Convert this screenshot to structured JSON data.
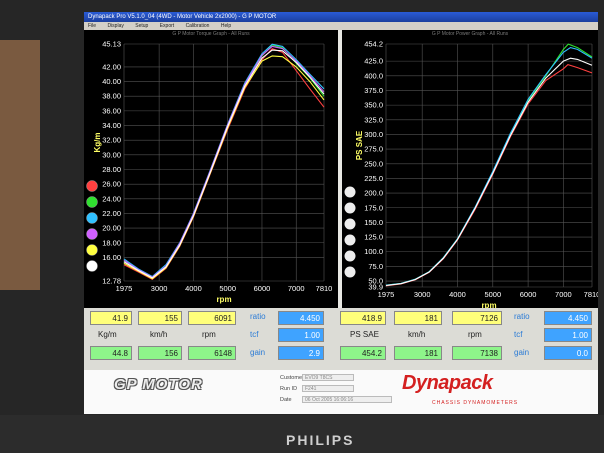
{
  "monitor": {
    "brand": "PHILIPS"
  },
  "window": {
    "title": "Dynapack Pro V5.1.0_04 (4WD - Motor Vehicle 2x2000) - G P MOTOR",
    "menu": [
      "File",
      "Display",
      "Setup",
      "Export",
      "Calibration",
      "Help"
    ]
  },
  "left_chart": {
    "panel_title": "G P Motor Torque Graph - All Runs",
    "ylabel": "Kg/m",
    "xlabel": "rpm",
    "y_ticks": [
      "45.13",
      "42.00",
      "40.00",
      "38.00",
      "36.00",
      "34.00",
      "32.00",
      "30.00",
      "28.00",
      "26.00",
      "24.00",
      "22.00",
      "20.00",
      "18.00",
      "16.00",
      "12.78"
    ],
    "x_ticks": [
      "1975",
      "3000",
      "4000",
      "5000",
      "6000",
      "7000",
      "7810"
    ]
  },
  "right_chart": {
    "panel_title": "G P Motor Power Graph - All Runs",
    "ylabel": "PS SAE",
    "xlabel": "rpm",
    "y_ticks": [
      "454.2",
      "425.0",
      "400.0",
      "375.0",
      "350.0",
      "325.0",
      "300.0",
      "275.0",
      "250.0",
      "225.0",
      "200.0",
      "175.0",
      "150.0",
      "125.0",
      "100.0",
      "75.0",
      "50.0",
      "39.9"
    ],
    "x_ticks": [
      "1975",
      "3000",
      "4000",
      "5000",
      "6000",
      "7000",
      "7810"
    ]
  },
  "chart_data": [
    {
      "type": "line",
      "ylabel": "Kg/m",
      "xlabel": "rpm",
      "xlim": [
        1975,
        7810
      ],
      "ylim": [
        12.78,
        45.13
      ],
      "series": [
        {
          "color": "#ff4040",
          "x": [
            1975,
            2400,
            2800,
            3200,
            3600,
            4000,
            4500,
            5000,
            5500,
            6000,
            6300,
            6600,
            7000,
            7400,
            7810
          ],
          "y": [
            15.0,
            14.0,
            13.0,
            14.5,
            17.5,
            21.5,
            27.5,
            33.5,
            39.0,
            43.0,
            44.5,
            44.0,
            41.5,
            39.0,
            36.5
          ]
        },
        {
          "color": "#30e030",
          "x": [
            1975,
            2400,
            2800,
            3200,
            3600,
            4000,
            4500,
            5000,
            5500,
            6000,
            6300,
            6600,
            7000,
            7400,
            7810
          ],
          "y": [
            15.5,
            14.2,
            13.2,
            14.7,
            17.8,
            21.8,
            27.8,
            34.0,
            39.5,
            43.5,
            45.0,
            44.6,
            42.5,
            40.5,
            38.0
          ]
        },
        {
          "color": "#30c0ff",
          "x": [
            1975,
            2400,
            2800,
            3200,
            3600,
            4000,
            4500,
            5000,
            5500,
            6000,
            6300,
            6600,
            7000,
            7400,
            7810
          ],
          "y": [
            15.8,
            14.4,
            13.4,
            15.0,
            18.0,
            22.0,
            28.0,
            34.2,
            39.8,
            43.8,
            45.1,
            44.8,
            43.0,
            41.0,
            39.0
          ]
        },
        {
          "color": "#d060ff",
          "x": [
            1975,
            2400,
            2800,
            3200,
            3600,
            4000,
            4500,
            5000,
            5500,
            6000,
            6300,
            6600,
            7000,
            7400,
            7810
          ],
          "y": [
            15.6,
            14.3,
            13.3,
            14.8,
            17.9,
            21.9,
            27.9,
            34.1,
            39.6,
            43.6,
            44.8,
            44.5,
            42.8,
            40.8,
            38.6
          ]
        },
        {
          "color": "#ffff40",
          "x": [
            1975,
            2400,
            2800,
            3200,
            3600,
            4000,
            4500,
            5000,
            5500,
            6000,
            6300,
            6600,
            7000,
            7400,
            7810
          ],
          "y": [
            15.2,
            14.1,
            13.1,
            14.6,
            17.6,
            21.6,
            27.6,
            33.7,
            39.2,
            42.8,
            43.5,
            43.4,
            42.0,
            40.0,
            37.5
          ]
        },
        {
          "color": "#ffffff",
          "x": [
            1975,
            2400,
            2800,
            3200,
            3600,
            4000,
            4500,
            5000,
            5500,
            6000,
            6300,
            6600,
            7000,
            7400,
            7810
          ],
          "y": [
            15.4,
            14.2,
            13.2,
            14.7,
            17.7,
            21.7,
            27.7,
            33.9,
            39.4,
            43.2,
            44.3,
            44.2,
            42.6,
            40.6,
            38.3
          ]
        }
      ]
    },
    {
      "type": "line",
      "ylabel": "PS SAE",
      "xlabel": "rpm",
      "xlim": [
        1975,
        7810
      ],
      "ylim": [
        39.9,
        454.2
      ],
      "series": [
        {
          "color": "#ff4040",
          "x": [
            1975,
            2400,
            2800,
            3200,
            3600,
            4000,
            4500,
            5000,
            5500,
            6000,
            6500,
            7000,
            7126,
            7400,
            7810
          ],
          "y": [
            42,
            45,
            52,
            65,
            88,
            120,
            172,
            232,
            296,
            352,
            392,
            412,
            419,
            414,
            405
          ]
        },
        {
          "color": "#30e030",
          "x": [
            1975,
            2400,
            2800,
            3200,
            3600,
            4000,
            4500,
            5000,
            5500,
            6000,
            6500,
            7000,
            7138,
            7400,
            7810
          ],
          "y": [
            43,
            46,
            53,
            66,
            90,
            122,
            175,
            236,
            300,
            358,
            400,
            445,
            454,
            448,
            432
          ]
        },
        {
          "color": "#30c0ff",
          "x": [
            1975,
            2400,
            2800,
            3200,
            3600,
            4000,
            4500,
            5000,
            5500,
            6000,
            6500,
            7000,
            7200,
            7400,
            7810
          ],
          "y": [
            43,
            46,
            53,
            66,
            90,
            122,
            176,
            237,
            302,
            360,
            402,
            440,
            448,
            445,
            430
          ]
        },
        {
          "color": "#ffffff",
          "x": [
            1975,
            2400,
            2800,
            3200,
            3600,
            4000,
            4500,
            5000,
            5500,
            6000,
            6500,
            7000,
            7200,
            7400,
            7810
          ],
          "y": [
            42.5,
            45.5,
            52.5,
            65.5,
            89,
            121,
            174,
            234,
            298,
            355,
            396,
            425,
            430,
            428,
            418
          ]
        }
      ]
    }
  ],
  "readouts": {
    "left": {
      "row1": [
        "41.9",
        "155",
        "6091"
      ],
      "labels": [
        "Kg/m",
        "km/h",
        "rpm"
      ],
      "row2": [
        "44.8",
        "156",
        "6148"
      ],
      "side_labels": [
        "ratio",
        "tcf",
        "gain"
      ],
      "side_values": [
        "4.450",
        "1.00",
        "2.9"
      ]
    },
    "right": {
      "row1": [
        "418.9",
        "181",
        "7126"
      ],
      "labels": [
        "PS SAE",
        "km/h",
        "rpm"
      ],
      "row2": [
        "454.2",
        "181",
        "7138"
      ],
      "side_labels": [
        "ratio",
        "tcf",
        "gain"
      ],
      "side_values": [
        "4.450",
        "1.00",
        "0.0"
      ]
    }
  },
  "footer": {
    "shop_logo": "GP MOTOR",
    "meta_labels": [
      "Customer",
      "Run ID",
      "Date"
    ],
    "meta_values": [
      "EVO9 T8CS",
      "F241",
      "06 Oct 2005  16:06:16"
    ],
    "brand_logo": "Dynapack",
    "brand_sub": "CHASSIS DYNAMOMETERS"
  }
}
